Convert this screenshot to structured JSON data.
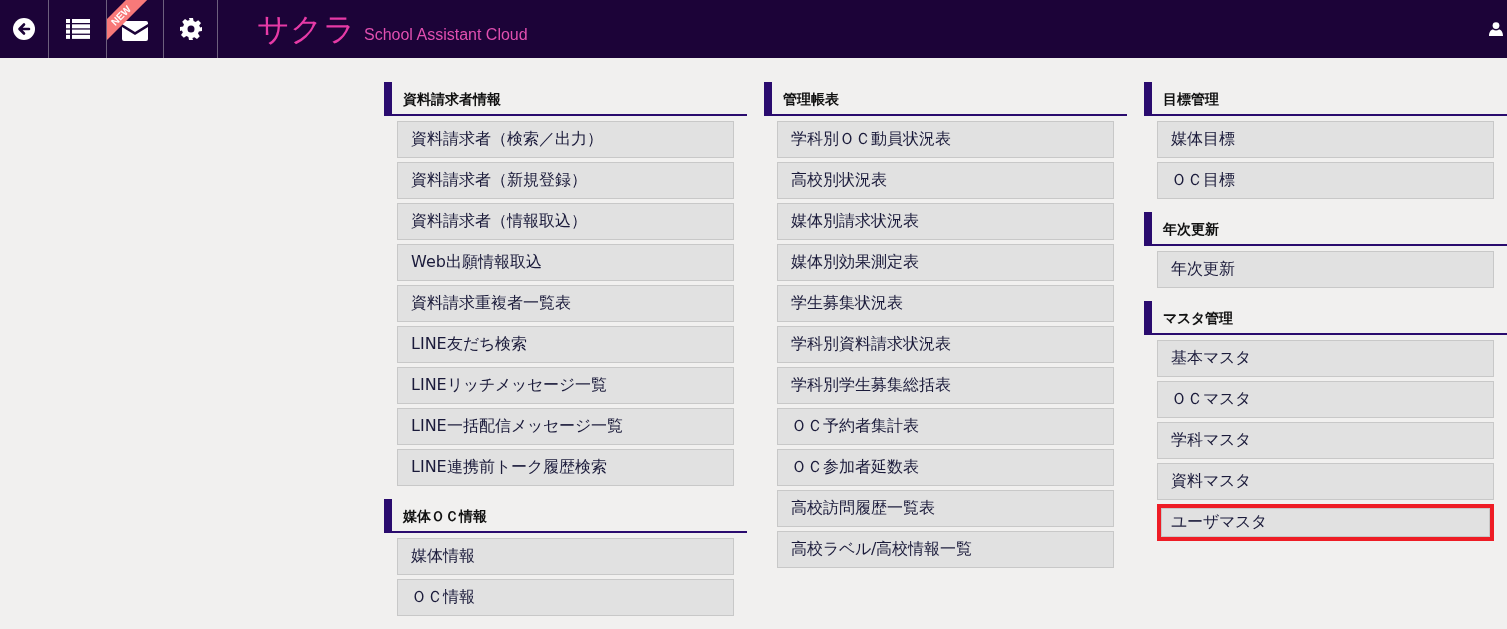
{
  "header": {
    "new_badge": "NEW",
    "logo": "サクラ",
    "subtitle": "School Assistant Cloud"
  },
  "columns": [
    {
      "sections": [
        {
          "title": "資料請求者情報",
          "items": [
            {
              "label": "資料請求者（検索／出力）",
              "highlighted": false
            },
            {
              "label": "資料請求者（新規登録）",
              "highlighted": false
            },
            {
              "label": "資料請求者（情報取込）",
              "highlighted": false
            },
            {
              "label": "Web出願情報取込",
              "highlighted": false
            },
            {
              "label": "資料請求重複者一覧表",
              "highlighted": false
            },
            {
              "label": "LINE友だち検索",
              "highlighted": false
            },
            {
              "label": "LINEリッチメッセージ一覧",
              "highlighted": false
            },
            {
              "label": "LINE一括配信メッセージ一覧",
              "highlighted": false
            },
            {
              "label": "LINE連携前トーク履歴検索",
              "highlighted": false
            }
          ]
        },
        {
          "title": "媒体ＯＣ情報",
          "items": [
            {
              "label": "媒体情報",
              "highlighted": false
            },
            {
              "label": "ＯＣ情報",
              "highlighted": false
            }
          ]
        }
      ]
    },
    {
      "sections": [
        {
          "title": "管理帳表",
          "items": [
            {
              "label": "学科別ＯＣ動員状況表",
              "highlighted": false
            },
            {
              "label": "高校別状況表",
              "highlighted": false
            },
            {
              "label": "媒体別請求状況表",
              "highlighted": false
            },
            {
              "label": "媒体別効果測定表",
              "highlighted": false
            },
            {
              "label": "学生募集状況表",
              "highlighted": false
            },
            {
              "label": "学科別資料請求状況表",
              "highlighted": false
            },
            {
              "label": "学科別学生募集総括表",
              "highlighted": false
            },
            {
              "label": "ＯＣ予約者集計表",
              "highlighted": false
            },
            {
              "label": "ＯＣ参加者延数表",
              "highlighted": false
            },
            {
              "label": "高校訪問履歴一覧表",
              "highlighted": false
            },
            {
              "label": "高校ラベル/高校情報一覧",
              "highlighted": false
            }
          ]
        }
      ]
    },
    {
      "sections": [
        {
          "title": "目標管理",
          "items": [
            {
              "label": "媒体目標",
              "highlighted": false
            },
            {
              "label": "ＯＣ目標",
              "highlighted": false
            }
          ]
        },
        {
          "title": "年次更新",
          "items": [
            {
              "label": "年次更新",
              "highlighted": false
            }
          ]
        },
        {
          "title": "マスタ管理",
          "items": [
            {
              "label": "基本マスタ",
              "highlighted": false
            },
            {
              "label": "ＯＣマスタ",
              "highlighted": false
            },
            {
              "label": "学科マスタ",
              "highlighted": false
            },
            {
              "label": "資料マスタ",
              "highlighted": false
            },
            {
              "label": "ユーザマスタ",
              "highlighted": true
            }
          ]
        }
      ]
    }
  ]
}
